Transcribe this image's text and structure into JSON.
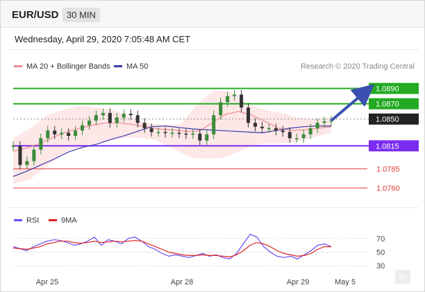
{
  "header": {
    "pair": "EUR/USD",
    "timeframe": "30 MIN"
  },
  "timestamp": "Wednesday, April 29, 2020 7:05:48 AM CET",
  "credit": "Research © 2020 Trading Central",
  "colors": {
    "bollinger": "#f08a8a",
    "bollinger_fill": "#fde4e4",
    "ma50": "#3a3aa8",
    "green": "#22aa22",
    "purple": "#7a2cf0",
    "red": "#e03a3a",
    "dark": "#222222",
    "rsi": "#6a4cf5",
    "rsi9": "#e02020",
    "candle_up": "#3a8a3a",
    "candle_down": "#333333",
    "arrow": "#3a50b0"
  },
  "chart_data": [
    {
      "type": "candlestick",
      "title": "",
      "legend": [
        {
          "label": "MA 20 + Bollinger Bands",
          "color": "#f08a8a"
        },
        {
          "label": "MA 50",
          "color": "#3a3aa8"
        }
      ],
      "x_ticks": [
        "Apr 25",
        "Apr 28",
        "Apr 29",
        "May 5"
      ],
      "ylim": [
        1.074,
        1.0905
      ],
      "levels": [
        {
          "value": 1.089,
          "label": "1.0890",
          "style": "green-solid",
          "flag": "green"
        },
        {
          "value": 1.087,
          "label": "1.0870",
          "style": "green-solid",
          "flag": "green"
        },
        {
          "value": 1.085,
          "label": "1.0850",
          "style": "dotted",
          "flag": "dark"
        },
        {
          "value": 1.0815,
          "label": "1.0815",
          "style": "purple-solid",
          "flag": "purple"
        },
        {
          "value": 1.0785,
          "label": "1.0785",
          "style": "red-thin",
          "flag": "text"
        },
        {
          "value": 1.076,
          "label": "1.0760",
          "style": "red-thin",
          "flag": "text"
        }
      ],
      "price_path": [
        1.0815,
        1.079,
        1.0795,
        1.081,
        1.0825,
        1.0835,
        1.083,
        1.0832,
        1.0828,
        1.0835,
        1.0842,
        1.0848,
        1.0855,
        1.0858,
        1.0845,
        1.0852,
        1.0857,
        1.0855,
        1.0845,
        1.0838,
        1.0833,
        1.0833,
        1.0832,
        1.0832,
        1.0831,
        1.083,
        1.0831,
        1.0822,
        1.083,
        1.0855,
        1.0872,
        1.088,
        1.0882,
        1.0865,
        1.0845,
        1.084,
        1.0838,
        1.0838,
        1.0835,
        1.0833,
        1.0825,
        1.0825,
        1.083,
        1.0838,
        1.0845,
        1.0847,
        1.0848
      ],
      "ma50_path": [
        1.0775,
        1.0782,
        1.079,
        1.0798,
        1.0807,
        1.0813,
        1.0817,
        1.0823,
        1.0828,
        1.0834,
        1.084,
        1.0841,
        1.0839,
        1.0837,
        1.0836,
        1.0835,
        1.0834,
        1.0833,
        1.0832,
        1.0835,
        1.0838,
        1.084,
        1.0841,
        1.0841
      ],
      "ma20_path": [
        1.0808,
        1.0812,
        1.0818,
        1.0826,
        1.0833,
        1.0838,
        1.0842,
        1.0845,
        1.0845,
        1.0843,
        1.084,
        1.0837,
        1.0836,
        1.0834,
        1.0834,
        1.0845,
        1.0856,
        1.086,
        1.0855,
        1.0847,
        1.0838,
        1.0835,
        1.0836,
        1.0838,
        1.084
      ],
      "bollinger_upper": [
        1.0825,
        1.0838,
        1.0855,
        1.0862,
        1.0867,
        1.0865,
        1.0862,
        1.0852,
        1.0845,
        1.0842,
        1.0843,
        1.087,
        1.0888,
        1.0885,
        1.087,
        1.0862,
        1.0858,
        1.0852,
        1.085,
        1.0852
      ],
      "bollinger_lower": [
        1.0765,
        1.0772,
        1.079,
        1.0808,
        1.0815,
        1.082,
        1.0825,
        1.0826,
        1.0823,
        1.0812,
        1.08,
        1.0798,
        1.08,
        1.081,
        1.0818,
        1.0818,
        1.082,
        1.0826,
        1.0832
      ],
      "projection": {
        "from": 1.0848,
        "to": 1.089
      }
    },
    {
      "type": "line",
      "title": "",
      "legend": [
        {
          "label": "RSI",
          "color": "#6a4cf5"
        },
        {
          "label": "9MA",
          "color": "#e02020"
        }
      ],
      "ylim": [
        20,
        85
      ],
      "y_ticks": [
        30,
        50,
        70
      ],
      "series": [
        {
          "name": "RSI",
          "values": [
            58,
            55,
            52,
            58,
            62,
            66,
            68,
            67,
            64,
            60,
            62,
            66,
            72,
            60,
            68,
            66,
            62,
            70,
            72,
            66,
            58,
            54,
            48,
            44,
            46,
            44,
            42,
            45,
            48,
            44,
            46,
            42,
            40,
            48,
            62,
            76,
            72,
            58,
            50,
            44,
            42,
            44,
            40,
            46,
            52,
            60,
            62,
            58
          ]
        },
        {
          "name": "9MA",
          "values": [
            56,
            55,
            54,
            56,
            58,
            62,
            64,
            66,
            66,
            64,
            63,
            64,
            66,
            64,
            65,
            66,
            65,
            66,
            67,
            66,
            62,
            58,
            54,
            50,
            48,
            46,
            45,
            45,
            46,
            45,
            45,
            44,
            43,
            46,
            52,
            60,
            64,
            62,
            58,
            52,
            48,
            46,
            44,
            45,
            48,
            54,
            58,
            58
          ]
        }
      ]
    }
  ]
}
